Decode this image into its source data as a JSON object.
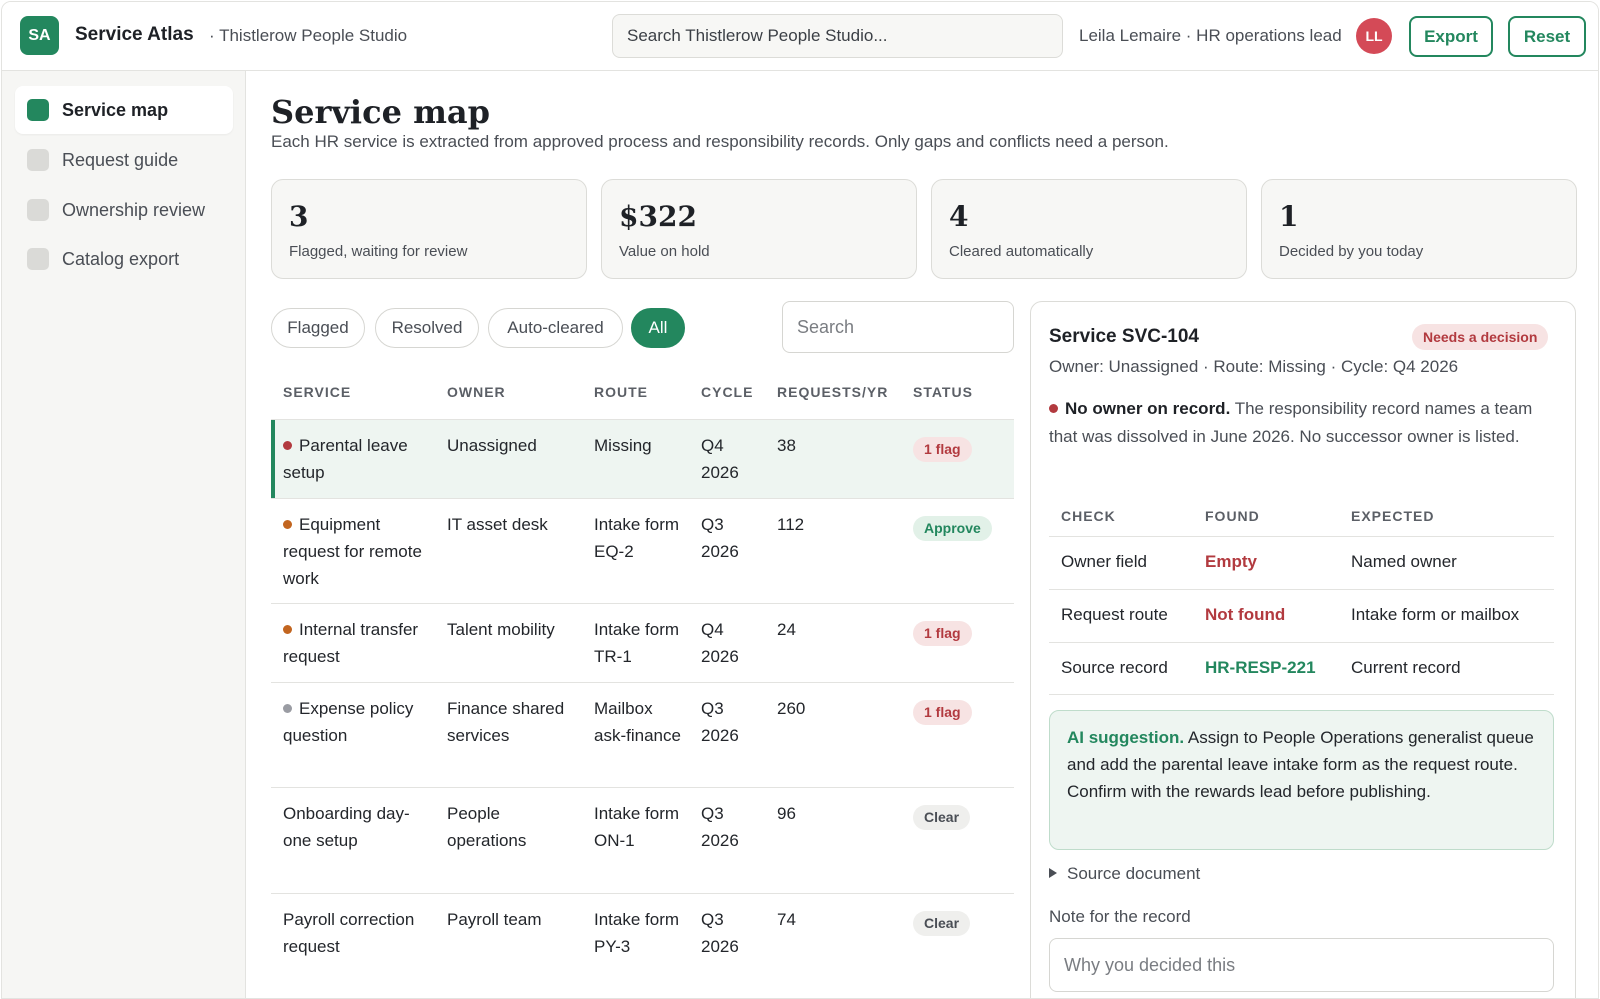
{
  "header": {
    "logo_text": "SA",
    "app_name": "Service Atlas",
    "workspace": "· Thistlerow People Studio",
    "search_placeholder": "Search Thistlerow People Studio...",
    "user": "Leila Lemaire · HR operations lead",
    "avatar_initials": "LL",
    "export_label": "Export",
    "reset_label": "Reset"
  },
  "sidebar": {
    "items": [
      {
        "label": "Service map",
        "active": true
      },
      {
        "label": "Request guide",
        "active": false
      },
      {
        "label": "Ownership review",
        "active": false
      },
      {
        "label": "Catalog export",
        "active": false
      }
    ]
  },
  "page": {
    "title": "Service map",
    "subtitle": "Each HR service is extracted from approved process and responsibility records. Only gaps and conflicts need a person."
  },
  "stats": [
    {
      "value": "3",
      "caption": "Flagged, waiting for review"
    },
    {
      "value": "$322",
      "caption": "Value on hold"
    },
    {
      "value": "4",
      "caption": "Cleared automatically"
    },
    {
      "value": "1",
      "caption": "Decided by you today"
    }
  ],
  "filters": {
    "chips": [
      "Flagged",
      "Resolved",
      "Auto-cleared",
      "All"
    ],
    "active": "All",
    "search_placeholder": "Search"
  },
  "table": {
    "headers": [
      "SERVICE",
      "OWNER",
      "ROUTE",
      "CYCLE",
      "REQUESTS/YR",
      "STATUS"
    ],
    "rows": [
      {
        "service": "Parental leave setup",
        "dot": "#b23a3f",
        "owner": "Unassigned",
        "route": "Missing",
        "cycle": "Q4 2026",
        "requests": "38",
        "status": "1 flag",
        "status_type": "flag",
        "selected": true
      },
      {
        "service": "Equipment request for remote work",
        "dot": "#c2651f",
        "owner": "IT asset desk",
        "route": "Intake form EQ-2",
        "cycle": "Q3 2026",
        "requests": "112",
        "status": "Approve",
        "status_type": "approve",
        "selected": false
      },
      {
        "service": "Internal transfer request",
        "dot": "#c2651f",
        "owner": "Talent mobility",
        "route": "Intake form TR-1",
        "cycle": "Q4 2026",
        "requests": "24",
        "status": "1 flag",
        "status_type": "flag",
        "selected": false
      },
      {
        "service": "Expense policy question",
        "dot": "#9a9ca3",
        "owner": "Finance shared services",
        "route": "Mailbox ask-finance",
        "cycle": "Q3 2026",
        "requests": "260",
        "status": "1 flag",
        "status_type": "flag",
        "selected": false
      },
      {
        "service": "Onboarding day-one setup",
        "dot": "",
        "owner": "People operations",
        "route": "Intake form ON-1",
        "cycle": "Q3 2026",
        "requests": "96",
        "status": "Clear",
        "status_type": "clear",
        "selected": false
      },
      {
        "service": "Payroll correction request",
        "dot": "",
        "owner": "Payroll team",
        "route": "Intake form PY-3",
        "cycle": "Q3 2026",
        "requests": "74",
        "status": "Clear",
        "status_type": "clear",
        "selected": false
      }
    ]
  },
  "detail": {
    "title": "Service SVC-104",
    "badge": "Needs a decision",
    "meta": "Owner: Unassigned · Route: Missing · Cycle: Q4 2026",
    "issue_title": "No owner on record.",
    "issue_text": " The responsibility record names a team that was dissolved in June 2026. No successor owner is listed.",
    "checks_headers": [
      "CHECK",
      "FOUND",
      "EXPECTED"
    ],
    "checks": [
      {
        "check": "Owner field",
        "found": "Empty",
        "found_state": "bad",
        "expected": "Named owner"
      },
      {
        "check": "Request route",
        "found": "Not found",
        "found_state": "bad",
        "expected": "Intake form or mailbox"
      },
      {
        "check": "Source record",
        "found": "HR-RESP-221",
        "found_state": "good",
        "expected": "Current record"
      }
    ],
    "ai_label": "AI suggestion.",
    "ai_text": " Assign to People Operations generalist queue and add the parental leave intake form as the request route. Confirm with the rewards lead before publishing.",
    "source_doc_label": "Source document",
    "note_label": "Note for the record",
    "note_placeholder": "Why you decided this"
  }
}
